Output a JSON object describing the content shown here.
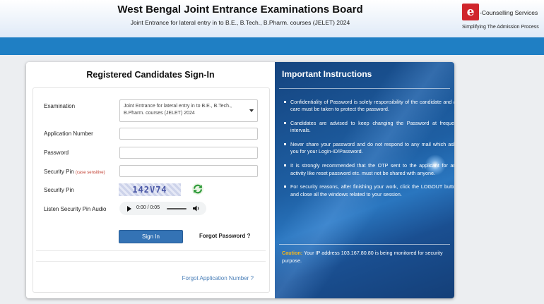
{
  "header": {
    "title": "West Bengal Joint Entrance Examinations Board",
    "subtitle": "Joint Entrance for lateral entry in to B.E., B.Tech., B.Pharm. courses (JELET) 2024",
    "logo_mark": "e",
    "logo_brand": "-Counselling Services",
    "logo_tagline": "Simplifying The Admission Process"
  },
  "signin": {
    "title": "Registered Candidates Sign-In",
    "examination_label": "Examination",
    "examination_value": "Joint Entrance for lateral entry in to B.E., B.Tech., B.Pharm. courses (JELET) 2024",
    "application_label": "Application Number",
    "password_label": "Password",
    "security_pin_label": "Security Pin",
    "case_sensitive": "(case sensitive)",
    "security_pin_image_label": "Security Pin",
    "captcha_text": "142V74",
    "audio_label": "Listen Security Pin Audio",
    "audio_time": "0:00 / 0:05",
    "signin_button": "Sign In",
    "forgot_password": "Forgot Password ?",
    "forgot_application": "Forgot Application Number ?"
  },
  "instructions": {
    "title": "Important Instructions",
    "items": [
      "Confidentiality of Password is solely responsibility of the candidate and all care must be taken to protect the password.",
      "Candidates are advised to keep changing the Password at frequent intervals.",
      "Never share your password and do not respond to any mail which asks you for your Login-ID/Password.",
      "It is strongly recommended that the OTP sent to the applicant for any activity like reset password etc. must not be shared with anyone.",
      "For security reasons, after finishing your work, click the LOGOUT button and close all the windows related to your session."
    ],
    "caution_label": "Caution:",
    "caution_text": "Your IP address 103.167.80.80 is being monitored for security purpose."
  },
  "colors": {
    "accent_blue": "#1f7fc4",
    "button_blue": "#3473b5",
    "panel_blue": "#1a4d8c",
    "caution": "#f5b81c"
  }
}
